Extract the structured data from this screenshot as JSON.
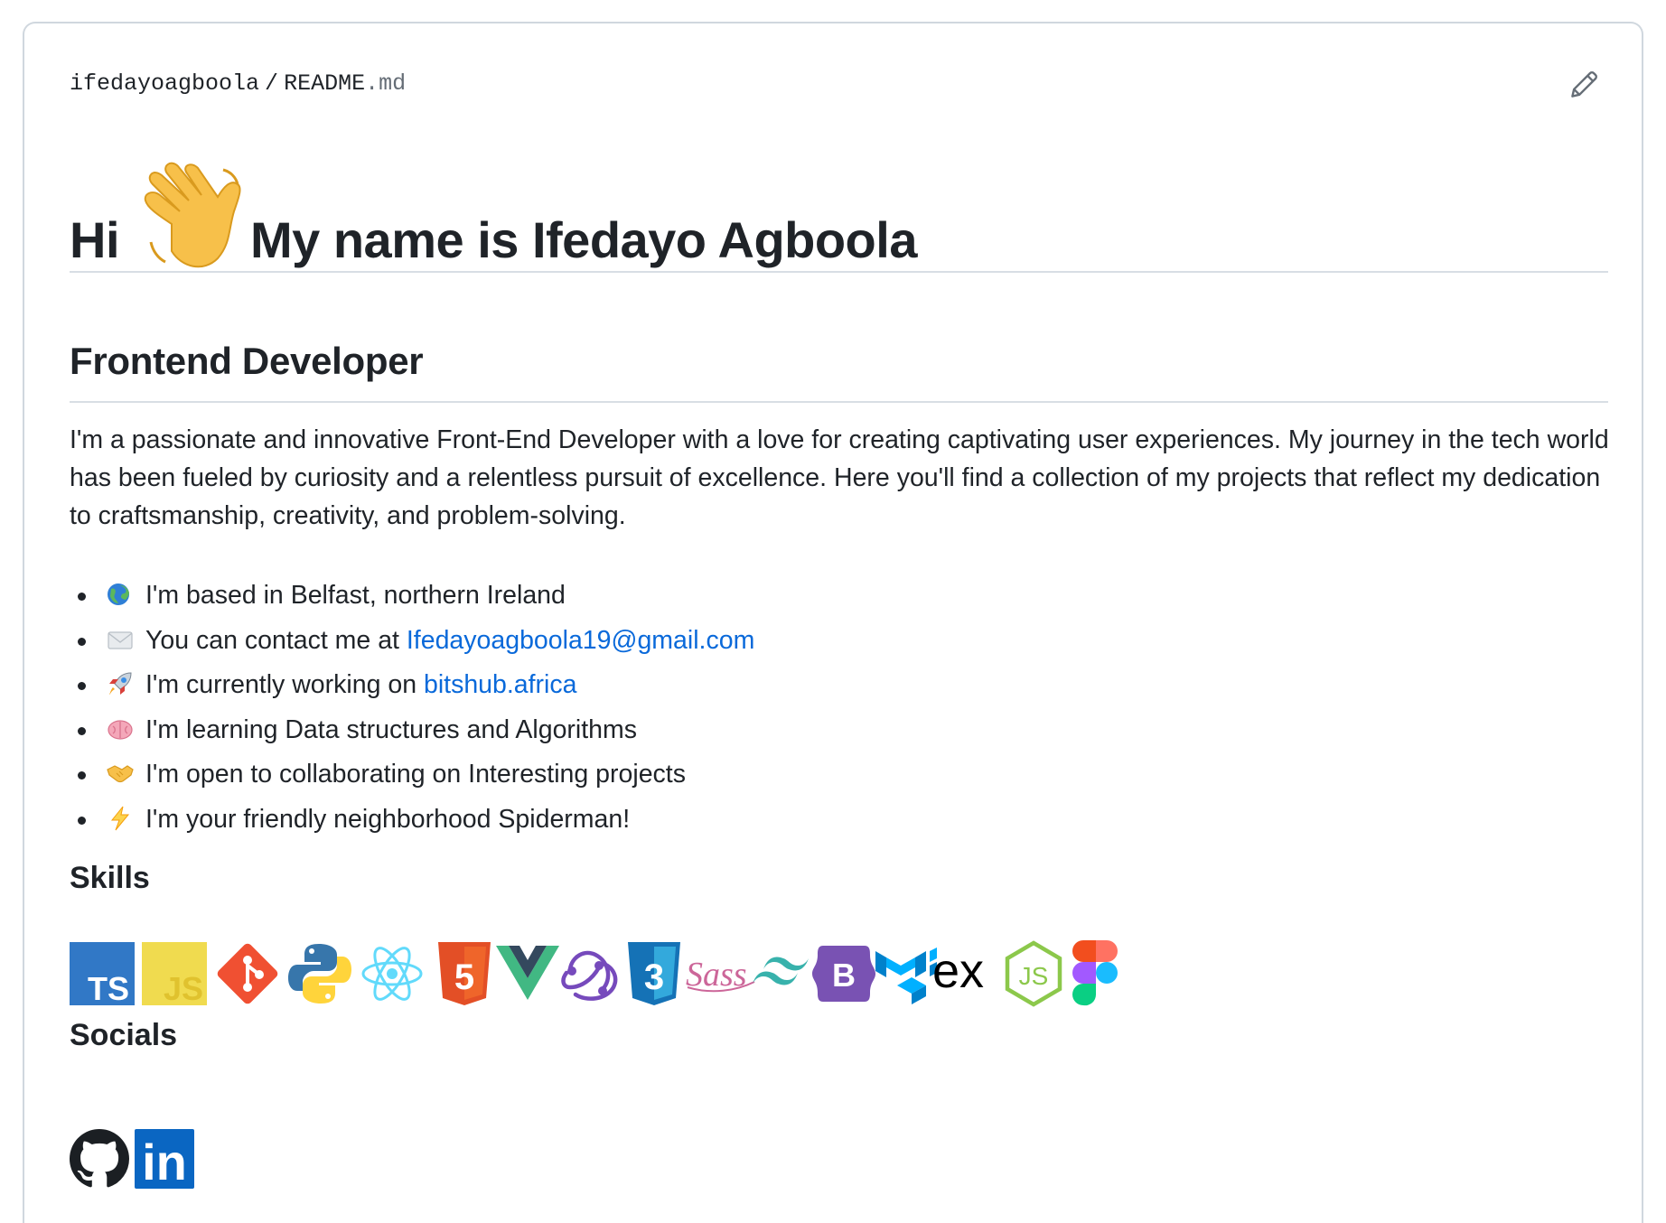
{
  "file_path": {
    "owner": "ifedayoagboola",
    "separator": "/",
    "filename": "README",
    "extension": ".md"
  },
  "edit_icon": "pencil-icon",
  "heading": {
    "hi": "Hi",
    "emoji": "waving-hand",
    "name": "My name is Ifedayo Agboola"
  },
  "subtitle": "Frontend Developer",
  "intro": "I'm a passionate and innovative Front-End Developer with a love for creating captivating user experiences. My journey in the tech world has been fueled by curiosity and a relentless pursuit of excellence. Here you'll find a collection of my projects that reflect my dedication to craftsmanship, creativity, and problem-solving.",
  "bullets": [
    {
      "emoji": "globe",
      "text": "I'm based in Belfast, northern Ireland"
    },
    {
      "emoji": "envelope",
      "text": "You can contact me at ",
      "link": "Ifedayoagboola19@gmail.com"
    },
    {
      "emoji": "rocket",
      "text": "I'm currently working on ",
      "link": "bitshub.africa"
    },
    {
      "emoji": "brain",
      "text": "I'm learning Data structures and Algorithms"
    },
    {
      "emoji": "handshake",
      "text": "I'm open to collaborating on Interesting projects"
    },
    {
      "emoji": "zap",
      "text": "I'm your friendly neighborhood Spiderman!"
    }
  ],
  "skills_heading": "Skills",
  "skills": [
    {
      "name": "typescript",
      "label": "TS",
      "color": "#3178c6"
    },
    {
      "name": "javascript",
      "label": "JS",
      "color": "#f0db4f"
    },
    {
      "name": "git",
      "color": "#f05032"
    },
    {
      "name": "python",
      "color": "#3776ab"
    },
    {
      "name": "react",
      "color": "#61dafb"
    },
    {
      "name": "html5",
      "label": "5",
      "color": "#e34f26"
    },
    {
      "name": "vue",
      "color": "#41b883"
    },
    {
      "name": "redux",
      "color": "#764abc"
    },
    {
      "name": "css3",
      "label": "3",
      "color": "#1572b6"
    },
    {
      "name": "sass",
      "label": "Sass",
      "color": "#cc6699"
    },
    {
      "name": "tailwind",
      "color": "#38b2ac"
    },
    {
      "name": "bootstrap",
      "label": "B",
      "color": "#7952b3"
    },
    {
      "name": "material-ui",
      "color": "#0081cb"
    },
    {
      "name": "express",
      "label": "ex",
      "color": "#000000"
    },
    {
      "name": "nodejs",
      "label": "JS",
      "color": "#8cc84b"
    },
    {
      "name": "figma",
      "color": "#f24e1e"
    }
  ],
  "socials_heading": "Socials",
  "socials": [
    {
      "name": "github",
      "color": "#1b1f23"
    },
    {
      "name": "linkedin",
      "label": "in",
      "color": "#0a66c2"
    }
  ]
}
